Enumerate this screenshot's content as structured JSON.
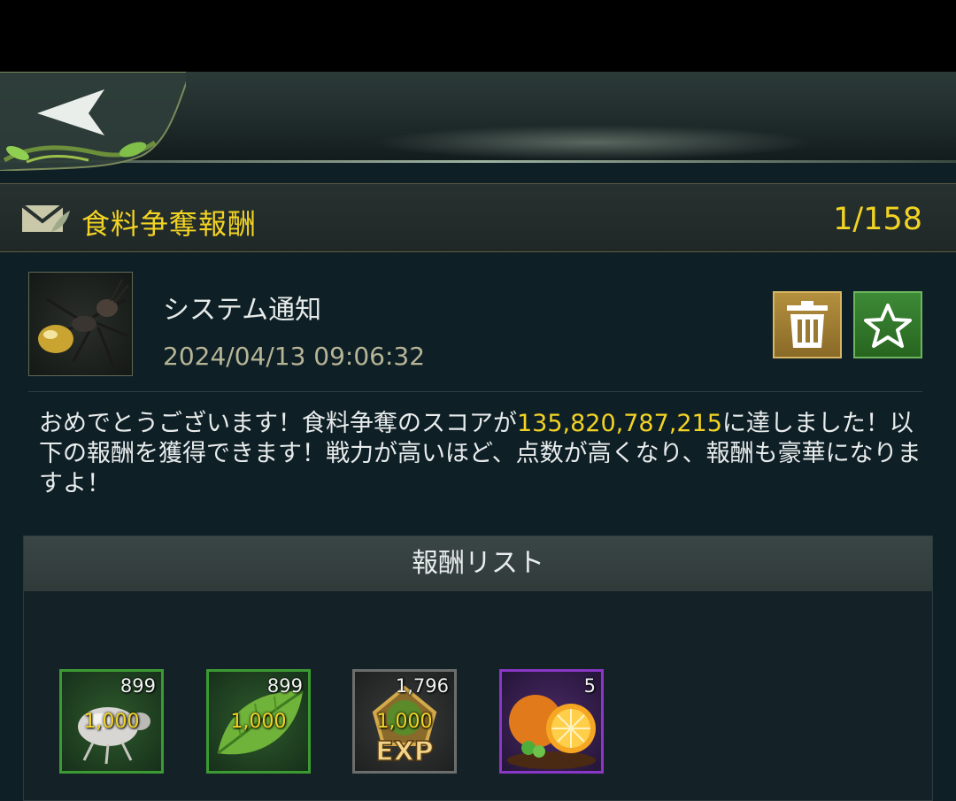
{
  "mail": {
    "title": "食料争奪報酬",
    "page_count": "1/158",
    "sender": "システム通知",
    "datetime": "2024/04/13 09:06:32",
    "message_before": "おめでとうございます！食料争奪のスコアが",
    "message_score": "135,820,787,215",
    "message_after": "に達しました！以下の報酬を獲得できます！戦力が高いほど、点数が高くなり、報酬も豪華になりますよ！"
  },
  "rewards": {
    "header": "報酬リスト",
    "items": [
      {
        "name": "aphid",
        "count": "899",
        "amount": "1,000",
        "frame": "green"
      },
      {
        "name": "leaf",
        "count": "899",
        "amount": "1,000",
        "frame": "green"
      },
      {
        "name": "exp",
        "count": "1,796",
        "amount": "1,000",
        "frame": "gray"
      },
      {
        "name": "fruit",
        "count": "5",
        "amount": "",
        "frame": "purple"
      }
    ]
  },
  "icons": {
    "back": "back-arrow-icon",
    "mail": "mail-icon",
    "delete": "trash-icon",
    "favorite": "star-icon"
  },
  "colors": {
    "accent_yellow": "#f2d324",
    "delete_button": "#a07f34",
    "favorite_button": "#2f7a28",
    "frame_green": "#3c9a33",
    "frame_purple": "#8a37c7"
  }
}
